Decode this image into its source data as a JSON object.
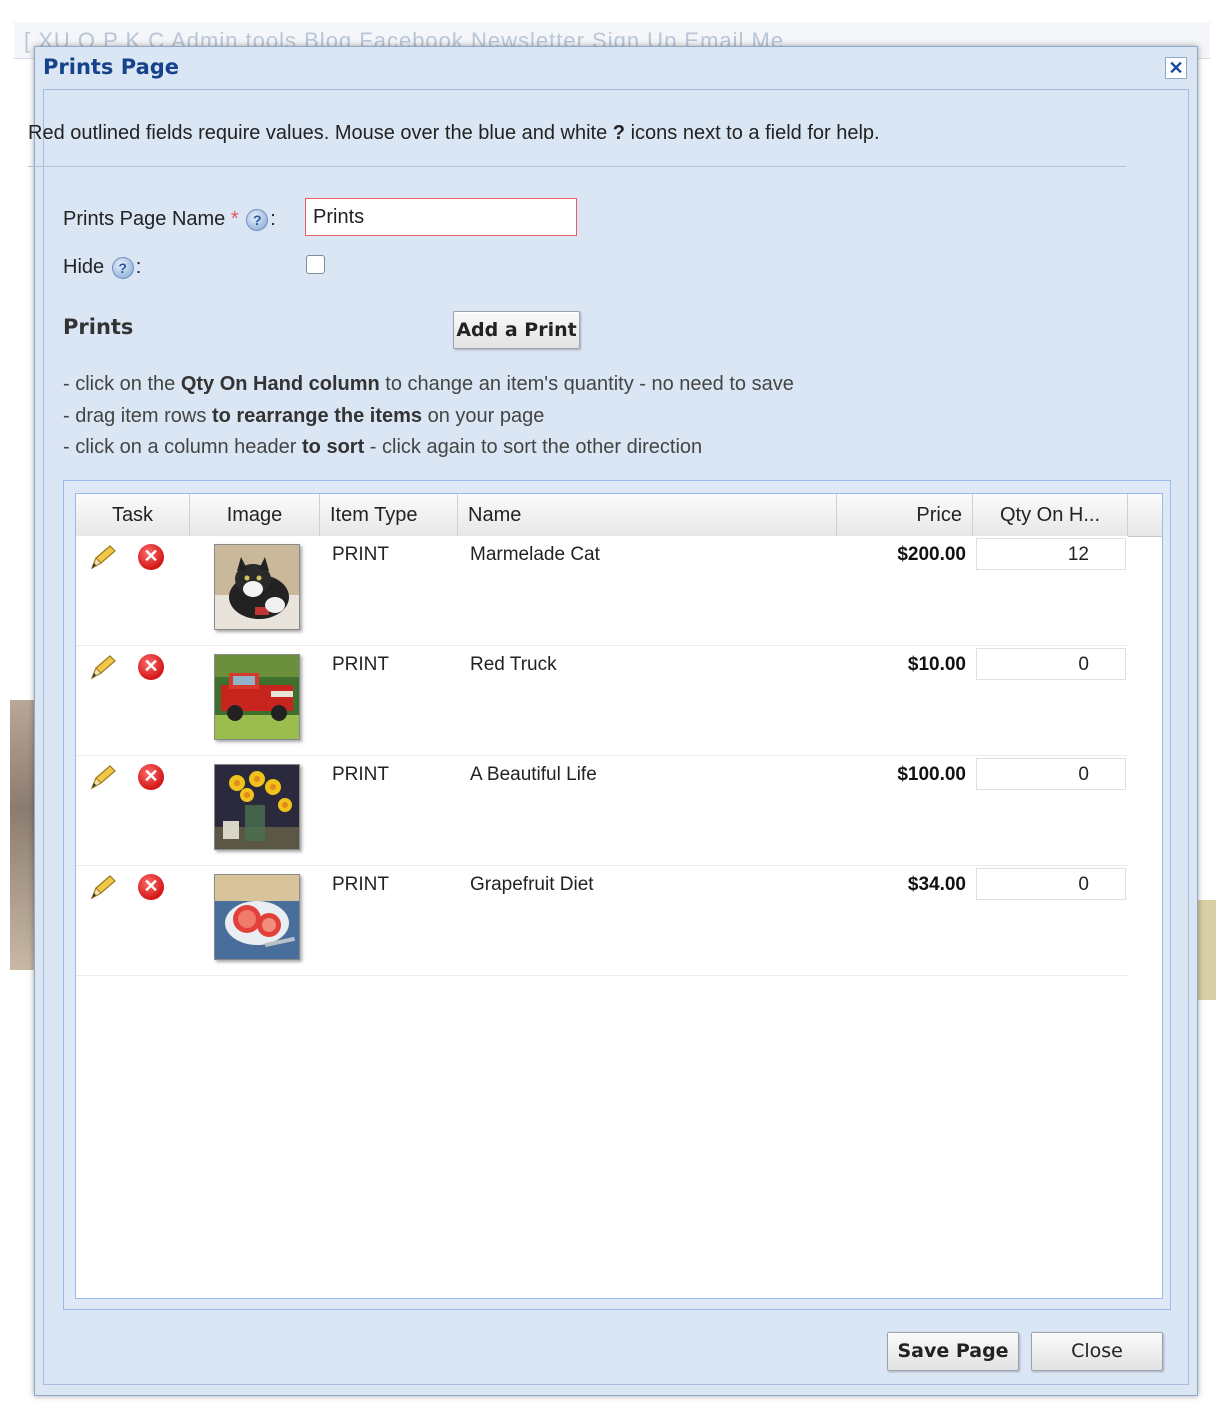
{
  "background": {
    "links_text": "[ XU O P K C   Admin tools   Blog  Facebook  Newsletter Sign Up   Email Me"
  },
  "dialog": {
    "title": "Prints Page",
    "close_glyph": "✕"
  },
  "help": {
    "text_before": "Red outlined fields require values. Mouse over the blue and white ",
    "text_bold": "?",
    "text_after": " icons next to a field for help."
  },
  "form": {
    "page_name_label": "Prints Page Name",
    "required_marker": "*",
    "help_glyph": "?",
    "colon": ":",
    "page_name_value": "Prints",
    "hide_label": "Hide",
    "hide_checked": false
  },
  "prints": {
    "heading": "Prints",
    "add_button": "Add a Print",
    "instructions": [
      {
        "a": "- click on the ",
        "b": "Qty On Hand column",
        "c": " to change an item's quantity - no need to save"
      },
      {
        "a": "- drag item rows ",
        "b": "to rearrange the items",
        "c": " on your page"
      },
      {
        "a": "- click on a column header ",
        "b": "to sort",
        "c": " - click again to sort the other direction"
      }
    ]
  },
  "grid": {
    "columns": {
      "task": "Task",
      "image": "Image",
      "item_type": "Item Type",
      "name": "Name",
      "price": "Price",
      "qty": "Qty On H..."
    },
    "rows": [
      {
        "type": "PRINT",
        "name": "Marmelade Cat",
        "price": "$200.00",
        "qty": "12",
        "image": "cat-painting"
      },
      {
        "type": "PRINT",
        "name": "Red Truck",
        "price": "$10.00",
        "qty": "0",
        "image": "red-truck-painting"
      },
      {
        "type": "PRINT",
        "name": "A Beautiful Life",
        "price": "$100.00",
        "qty": "0",
        "image": "daffodils-painting"
      },
      {
        "type": "PRINT",
        "name": "Grapefruit Diet",
        "price": "$34.00",
        "qty": "0",
        "image": "grapefruit-painting"
      }
    ],
    "task_icons": {
      "edit": "pencil-icon",
      "delete": "delete-icon",
      "delete_glyph": "✕"
    }
  },
  "footer": {
    "save_button": "Save Page",
    "close_button": "Close"
  },
  "colors": {
    "dialog_bg": "#dbe6f4",
    "title_blue": "#15428b",
    "required_red": "#e25a5a",
    "delete_red": "#d21717"
  }
}
